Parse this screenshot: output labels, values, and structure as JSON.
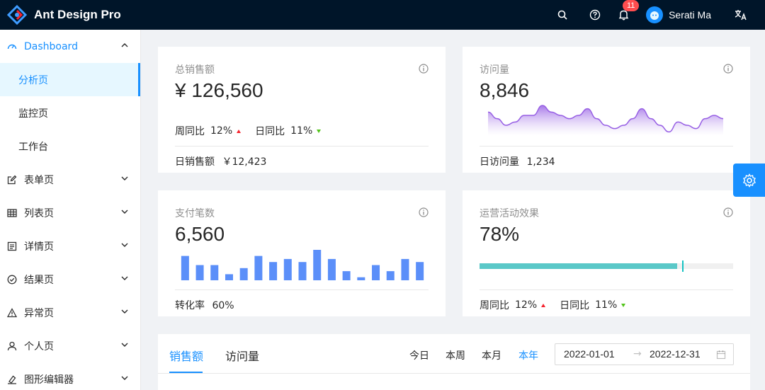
{
  "app": {
    "title": "Ant Design Pro"
  },
  "header": {
    "icons": [
      "search-icon",
      "question-icon",
      "bell-icon",
      "translate-icon"
    ],
    "notification_count": "11",
    "user_name": "Serati Ma"
  },
  "sidebar": {
    "items": [
      {
        "label": "Dashboard",
        "icon": "dashboard-icon",
        "expanded": true
      },
      {
        "label": "分析页",
        "selected": true
      },
      {
        "label": "监控页"
      },
      {
        "label": "工作台"
      },
      {
        "label": "表单页",
        "icon": "form-icon"
      },
      {
        "label": "列表页",
        "icon": "table-icon"
      },
      {
        "label": "详情页",
        "icon": "profile-icon"
      },
      {
        "label": "结果页",
        "icon": "check-circle-icon"
      },
      {
        "label": "异常页",
        "icon": "warning-icon"
      },
      {
        "label": "个人页",
        "icon": "user-icon"
      },
      {
        "label": "图形编辑器",
        "icon": "highlight-icon"
      }
    ]
  },
  "cards": {
    "sales": {
      "title": "总销售额",
      "value": "¥ 126,560",
      "week_label": "周同比",
      "week_value": "12%",
      "day_label": "日同比",
      "day_value": "11%",
      "footer_label": "日销售额",
      "footer_value": "￥12,423"
    },
    "visits": {
      "title": "访问量",
      "value": "8,846",
      "footer_label": "日访问量",
      "footer_value": "1,234"
    },
    "payments": {
      "title": "支付笔数",
      "value": "6,560",
      "footer_label": "转化率",
      "footer_value": "60%"
    },
    "operations": {
      "title": "运营活动效果",
      "value": "78%",
      "progress_percent": 78,
      "target_percent": 80,
      "week_label": "周同比",
      "week_value": "12%",
      "day_label": "日同比",
      "day_value": "11%"
    }
  },
  "mini_area_chart": {
    "type": "area",
    "values": [
      7,
      5,
      3,
      4,
      6,
      6,
      9,
      7,
      6,
      5,
      6,
      8,
      5,
      3,
      2,
      3,
      5,
      8,
      5,
      3,
      1,
      4,
      3,
      2,
      5,
      6,
      5
    ]
  },
  "mini_bar_chart": {
    "type": "bar",
    "values": [
      8,
      5,
      5,
      2,
      4,
      8,
      6,
      7,
      6,
      10,
      7,
      3,
      1,
      5,
      3,
      7,
      6
    ]
  },
  "sales_panel": {
    "tabs": [
      "销售额",
      "访问量"
    ],
    "active_tab": 0,
    "ranges": [
      "今日",
      "本周",
      "本月",
      "本年"
    ],
    "active_range": 3,
    "date_start": "2022-01-01",
    "date_end": "2022-12-31"
  },
  "colors": {
    "primary": "#1890ff",
    "header_bg": "#001529",
    "area_line": "#975fe4",
    "bar": "#5b8ff9",
    "progress": "#5ac8c8",
    "up": "#f5222d",
    "down": "#52c41a"
  }
}
